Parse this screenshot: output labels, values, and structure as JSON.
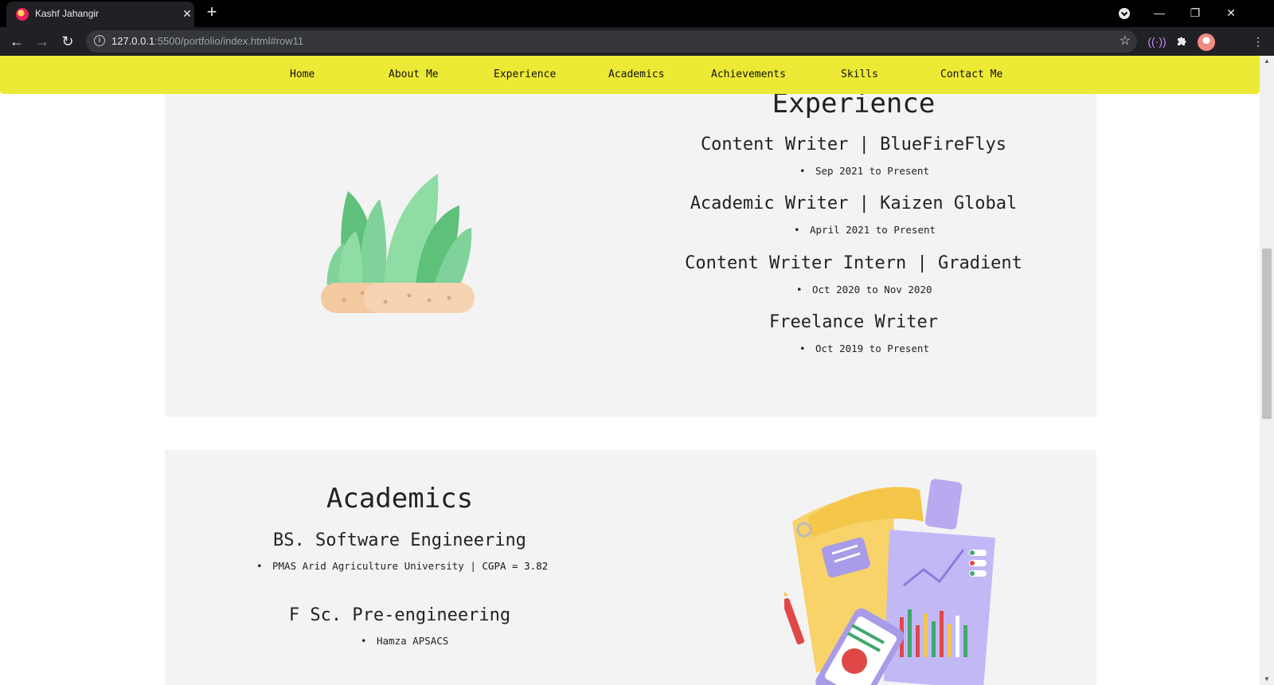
{
  "browser": {
    "tab_title": "Kashf Jahangir",
    "url_host": "127.0.0.1",
    "url_rest": ":5500/portfolio/index.html#row11"
  },
  "navbar": {
    "items": [
      "Home",
      "About Me",
      "Experience",
      "Academics",
      "Achievements",
      "Skills",
      "Contact Me"
    ]
  },
  "experience": {
    "heading": "Experience",
    "entries": [
      {
        "title": "Content Writer | BlueFireFlys",
        "period": "Sep 2021 to Present"
      },
      {
        "title": "Academic Writer | Kaizen Global",
        "period": "April 2021 to Present"
      },
      {
        "title": "Content Writer Intern | Gradient",
        "period": "Oct 2020 to Nov 2020"
      },
      {
        "title": "Freelance Writer",
        "period": "Oct 2019 to Present"
      }
    ]
  },
  "academics": {
    "heading": "Academics",
    "entries": [
      {
        "title": "BS. Software Engineering",
        "detail_a": "PMAS Arid Agriculture University | ",
        "detail_b": "CGPA = 3.82"
      },
      {
        "title": "F Sc. Pre-engineering",
        "detail_a": "Hamza APSACS",
        "detail_b": ""
      }
    ]
  },
  "colors": {
    "navbar_bg": "#ecea34",
    "section_bg": "#f3f3f3"
  }
}
